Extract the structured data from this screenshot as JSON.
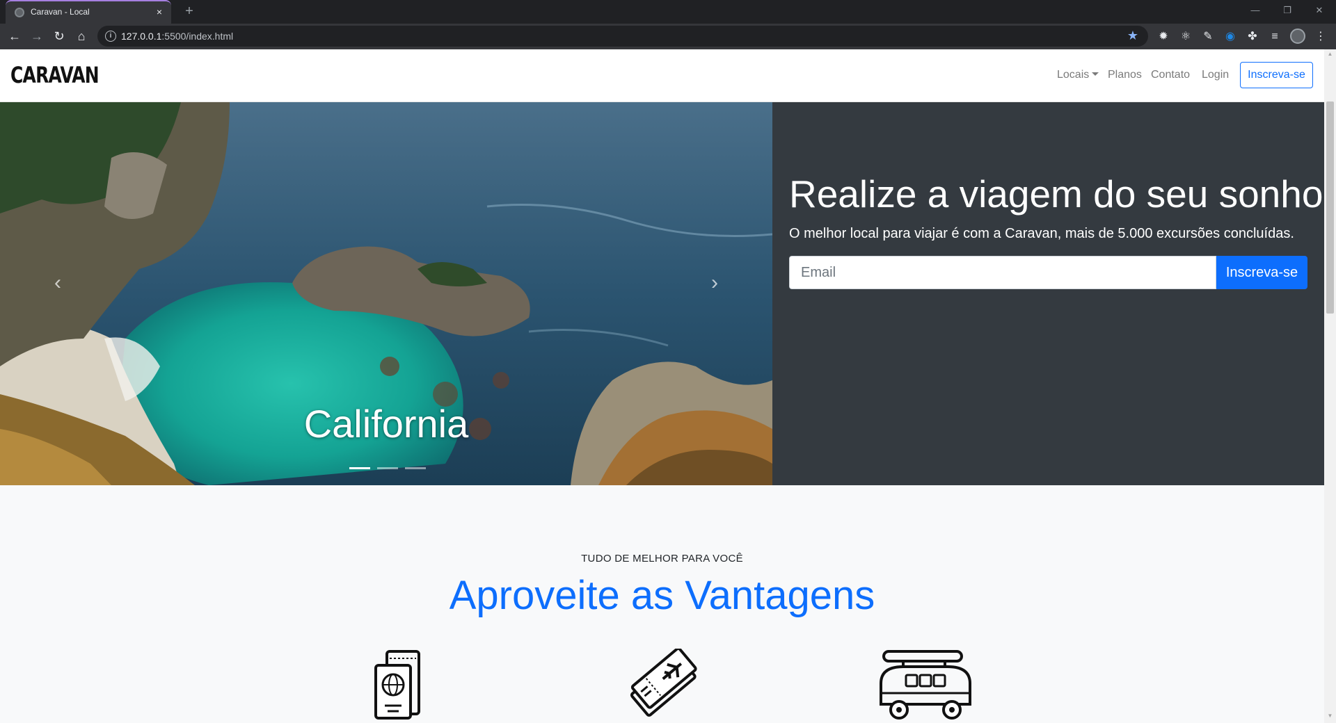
{
  "browser": {
    "tab_title": "Caravan - Local",
    "tab_close": "×",
    "new_tab": "+",
    "url_host": "127.0.0.1",
    "url_rest": ":5500/index.html",
    "window_controls": {
      "minimize": "—",
      "restore": "❐",
      "close": "✕"
    }
  },
  "navbar": {
    "brand": "CARAVAN",
    "links": {
      "locais": "Locais",
      "planos": "Planos",
      "contato": "Contato",
      "login": "Login"
    },
    "cta": "Inscreva-se"
  },
  "carousel": {
    "caption": "California",
    "prev": "‹",
    "next": "›",
    "slide_count": 3,
    "active_slide": 1
  },
  "hero": {
    "title": "Realize a viagem do seu sonho",
    "subtitle": "O melhor local para viajar é com a Caravan, mais de 5.000 excursões concluídas.",
    "email_placeholder": "Email",
    "button": "Inscreva-se"
  },
  "features": {
    "kicker": "TUDO DE MELHOR PARA VOCÊ",
    "title": "Aproveite as Vantagens",
    "icons": [
      "passport-icon",
      "plane-ticket-icon",
      "camper-van-icon"
    ]
  },
  "colors": {
    "primary": "#0d6efd",
    "hero_panel": "#343a40",
    "page_bg": "#f8f9fa"
  }
}
